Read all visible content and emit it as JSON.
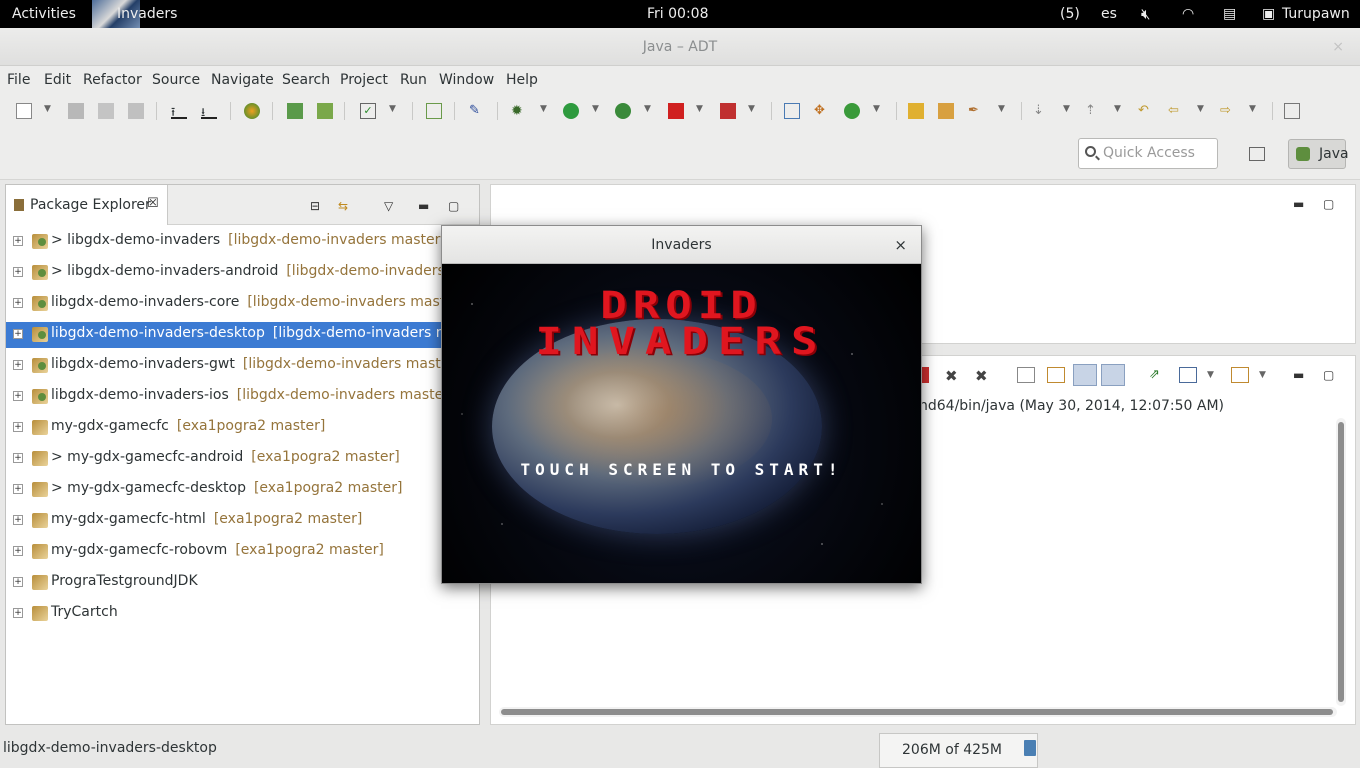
{
  "topbar": {
    "activities": "Activities",
    "app_name": "Invaders",
    "clock": "Fri 00:08",
    "notifications": "(5)",
    "keyboard_layout": "es",
    "user": "Turupawn"
  },
  "window": {
    "title": "Java – ADT",
    "close": "×"
  },
  "menu": {
    "items": [
      "File",
      "Edit",
      "Refactor",
      "Source",
      "Navigate",
      "Search",
      "Project",
      "Run",
      "Window",
      "Help"
    ]
  },
  "quick_access": {
    "placeholder": "Quick Access"
  },
  "perspective": {
    "label": "Java"
  },
  "package_explorer": {
    "tab_label": "Package Explorer",
    "tab_close": "☒",
    "items": [
      {
        "name": "> libgdx-demo-invaders",
        "tag": "[libgdx-demo-invaders master]"
      },
      {
        "name": "> libgdx-demo-invaders-android",
        "tag": "[libgdx-demo-invaders master]"
      },
      {
        "name": "libgdx-demo-invaders-core",
        "tag": "[libgdx-demo-invaders master]"
      },
      {
        "name": "libgdx-demo-invaders-desktop",
        "tag": "[libgdx-demo-invaders master]"
      },
      {
        "name": "libgdx-demo-invaders-gwt",
        "tag": "[libgdx-demo-invaders master]"
      },
      {
        "name": "libgdx-demo-invaders-ios",
        "tag": "[libgdx-demo-invaders master]"
      },
      {
        "name": "my-gdx-gamecfc",
        "tag": "[exa1pogra2 master]"
      },
      {
        "name": "> my-gdx-gamecfc-android",
        "tag": "[exa1pogra2 master]"
      },
      {
        "name": "> my-gdx-gamecfc-desktop",
        "tag": "[exa1pogra2 master]"
      },
      {
        "name": "my-gdx-gamecfc-html",
        "tag": "[exa1pogra2 master]"
      },
      {
        "name": "my-gdx-gamecfc-robovm",
        "tag": "[exa1pogra2 master]"
      },
      {
        "name": "PrograTestgroundJDK",
        "tag": ""
      },
      {
        "name": "TryCartch",
        "tag": ""
      }
    ],
    "selected_index": 3
  },
  "console": {
    "text": "nd64/bin/java (May 30, 2014, 12:07:50 AM)"
  },
  "status": {
    "selection": "libgdx-demo-invaders-desktop",
    "heap": "206M of 425M"
  },
  "dialog": {
    "title": "Invaders",
    "close": "×",
    "game_title_line1": "DROID",
    "game_title_line2": "INVADERS",
    "prompt": "TOUCH SCREEN TO START!"
  }
}
